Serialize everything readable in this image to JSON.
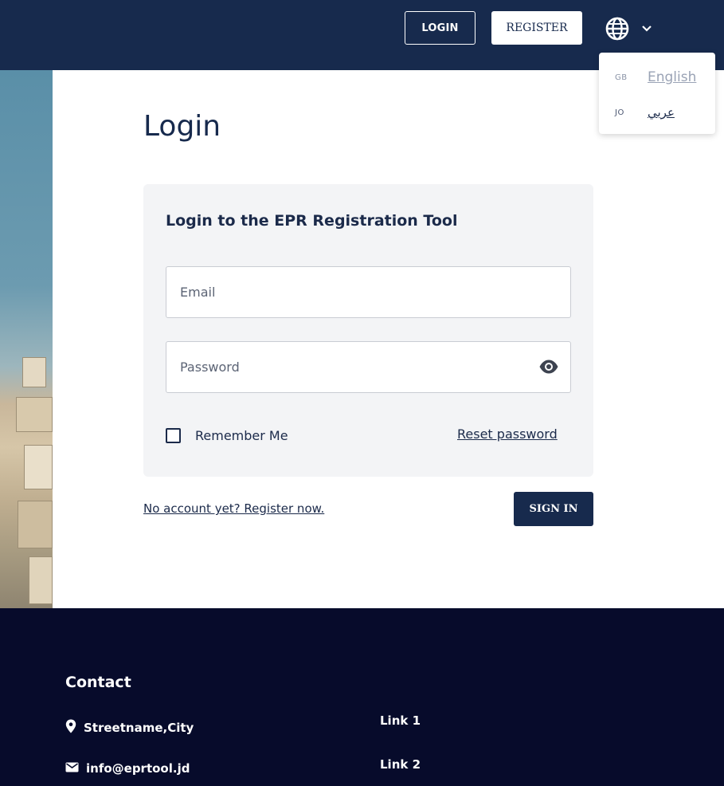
{
  "header": {
    "login_label": "LOGIN",
    "register_label": "REGISTER",
    "language_icon": "globe-icon",
    "dropdown_icon": "chevron-down-icon"
  },
  "language_menu": {
    "items": [
      {
        "code": "GB",
        "label": "English"
      },
      {
        "code": "JO",
        "label": "عربي"
      }
    ]
  },
  "main": {
    "title": "Login",
    "card_title": "Login to the EPR Registration Tool",
    "email_placeholder": "Email",
    "password_placeholder": "Password",
    "password_toggle_icon": "eye-icon",
    "remember_label": "Remember Me",
    "reset_label": "Reset password",
    "register_prompt": "No account yet? Register now.",
    "signin_label": "SIGN IN"
  },
  "footer": {
    "title": "Contact",
    "address": "Streetname,City",
    "address_icon": "location-pin-icon",
    "email": "info@eprtool.jd",
    "email_icon": "envelope-icon",
    "links": [
      "Link 1",
      "Link 2"
    ]
  },
  "colors": {
    "header_bg": "#172a4d",
    "footer_bg": "#070b2b",
    "card_bg": "#f3f4f6",
    "text_primary": "#1b2a4a"
  }
}
